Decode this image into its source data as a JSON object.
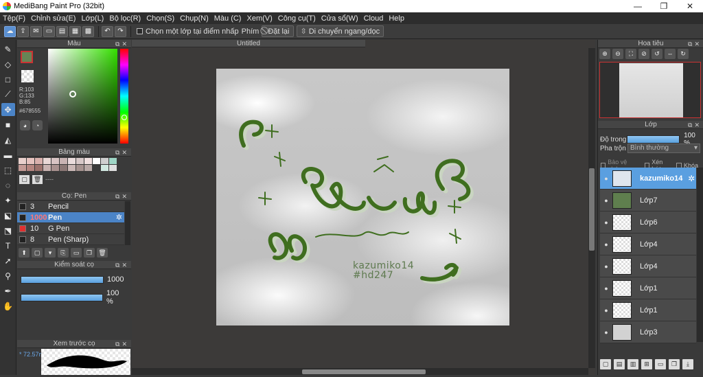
{
  "window": {
    "title": "MediBang Paint Pro (32bit)",
    "minimize": "—",
    "maximize": "❐",
    "close": "✕"
  },
  "menu": [
    "Tệp(F)",
    "Chỉnh sửa(E)",
    "Lớp(L)",
    "Bộ lọc(R)",
    "Chọn(S)",
    "Chụp(N)",
    "Màu (C)",
    "Xem(V)",
    "Công cụ(T)",
    "Cửa sổ(W)",
    "Cloud",
    "Help"
  ],
  "toolbar": {
    "select_layer_label": "Chọn một lớp tại điểm nhấp",
    "key_label": "Phím",
    "reset_label": "Đặt lại",
    "move_label": "Di chuyển ngang/dọc"
  },
  "color_panel": {
    "title": "Màu",
    "r": "R:103",
    "g": "G:133",
    "b": "B:85",
    "hex": "#678555",
    "current_color": "#678555"
  },
  "palette_panel": {
    "title": "Bảng màu",
    "swatches": [
      "#e8d0cc",
      "#e6c3bf",
      "#d9b0ac",
      "#e9d8d6",
      "#d8c4c4",
      "#c9b3b3",
      "#eadcdc",
      "#d7c8c8",
      "#f0e0e0",
      "#ffffff",
      "#cfcfcf",
      "#9fd6c6",
      "#c39a95",
      "#b5857f",
      "#9c726c",
      "#c8b2b0",
      "#a8918f",
      "#8b7775",
      "#cbb8b6",
      "#a5928f",
      "#b8a8a6",
      "#3a3a3a",
      "#d0e8e0",
      "#e0e0e0"
    ],
    "foot_text": "----"
  },
  "brush_panel": {
    "title": "Cọ: Pen",
    "items": [
      {
        "num": "3",
        "name": "Pencil",
        "color": "#222222"
      },
      {
        "num": "1000",
        "name": "Pen",
        "color": "#222222"
      },
      {
        "num": "10",
        "name": "G Pen",
        "color": "#e03030"
      },
      {
        "num": "8",
        "name": "Pen (Sharp)",
        "color": "#222222"
      }
    ]
  },
  "brush_control": {
    "title": "Kiểm soát cọ",
    "size": "1000",
    "opacity": "100 %"
  },
  "brush_preview": {
    "title": "Xem trước cọ",
    "size_text": "* 72.57m"
  },
  "canvas": {
    "tab_title": "Untitled",
    "sig_line1": "kazumiko14",
    "sig_line2": "#hd247",
    "accent_color": "#3f6e1f"
  },
  "navigator": {
    "title": "Hoa tiêu"
  },
  "layer_panel": {
    "title": "Lớp",
    "opacity_label": "Độ trong",
    "opacity_value": "100 %",
    "blend_label": "Pha trộn",
    "blend_value": "Bình thường",
    "protect_alpha": "Bảo vệ alpha",
    "clip": "Xén bớt",
    "lock": "Khóa",
    "layers": [
      {
        "name": "kazumiko14",
        "active": true,
        "thumb": "#dfe6ee"
      },
      {
        "name": "Lớp7",
        "active": false,
        "thumb": "#5f7f4e"
      },
      {
        "name": "Lớp6",
        "active": false,
        "thumb": ""
      },
      {
        "name": "Lớp4",
        "active": false,
        "thumb": ""
      },
      {
        "name": "Lớp4",
        "active": false,
        "thumb": ""
      },
      {
        "name": "Lớp1",
        "active": false,
        "thumb": ""
      },
      {
        "name": "Lớp1",
        "active": false,
        "thumb": ""
      },
      {
        "name": "Lớp3",
        "active": false,
        "thumb": "#d2d2d2"
      }
    ]
  }
}
